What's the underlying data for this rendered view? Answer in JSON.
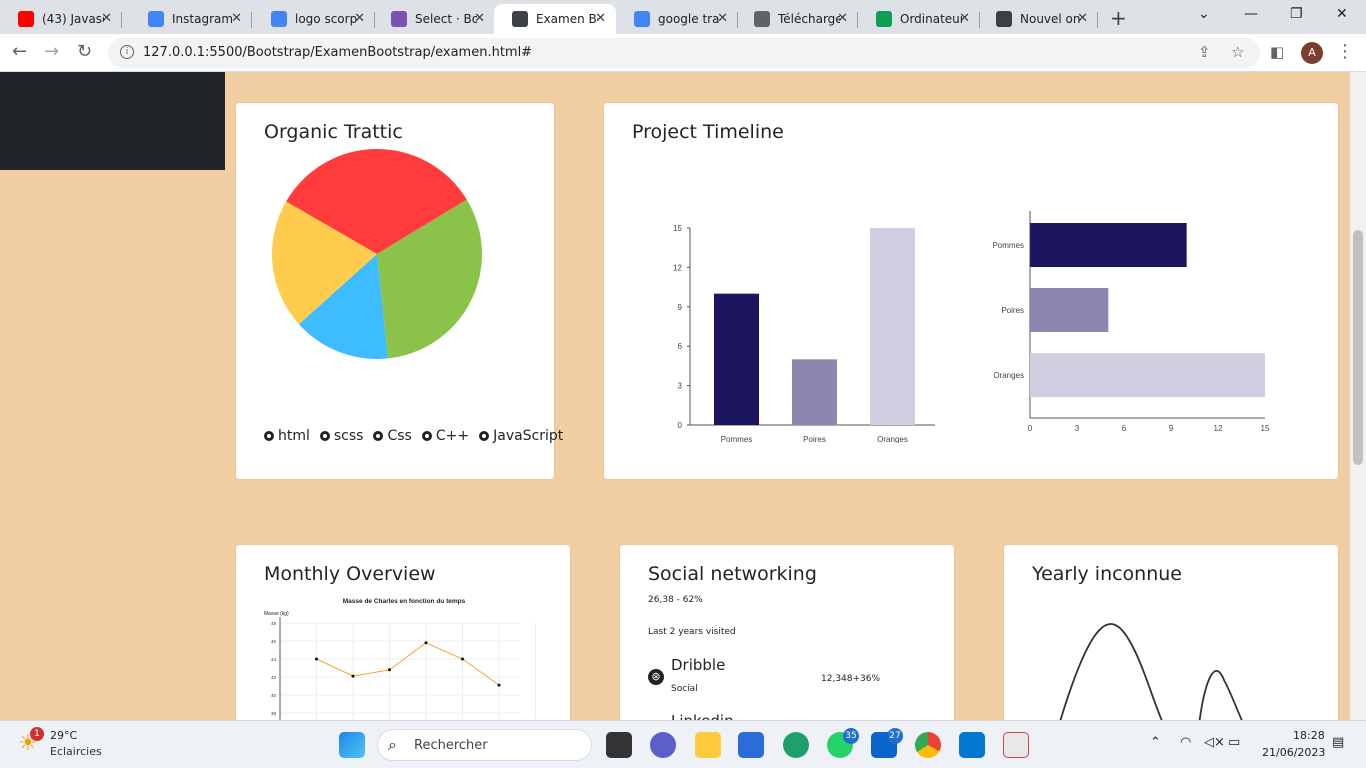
{
  "tabs": [
    {
      "label": "(43) Javasc",
      "icon": "youtube-icon",
      "color": "#ff0000"
    },
    {
      "label": "Instagram",
      "icon": "flag-icon",
      "color": "#4285f4"
    },
    {
      "label": "logo scorp",
      "icon": "google-icon",
      "color": "#4285f4"
    },
    {
      "label": "Select · Bo",
      "icon": "bootstrap-icon",
      "color": "#7952b3"
    },
    {
      "label": "Examen Bo",
      "icon": "globe-icon",
      "color": "#3c4043"
    },
    {
      "label": "google tra",
      "icon": "google-icon",
      "color": "#4285f4"
    },
    {
      "label": "Télécharge",
      "icon": "diamond-icon",
      "color": "#5f6368"
    },
    {
      "label": "Ordinateur",
      "icon": "drive-icon",
      "color": "#0f9d58"
    },
    {
      "label": "Nouvel on",
      "icon": "globe-icon",
      "color": "#3c4043"
    }
  ],
  "url": "127.0.0.1:5500/Bootstrap/ExamenBootstrap/examen.html#",
  "profile_initial": "A",
  "cards": {
    "organic": {
      "title": "Organic Trattic",
      "legend": [
        "html",
        "scss",
        "Css",
        "C++",
        "JavaScript"
      ]
    },
    "timeline": {
      "title": "Project Timeline"
    },
    "monthly": {
      "title": "Monthly Overview"
    },
    "social": {
      "title": "Social networking",
      "stat": "26,38 - 62%",
      "subtitle": "Last 2 years visited",
      "item_name": "Dribble",
      "item_sub": "Social",
      "item_value": "12,348+36%",
      "next_item": "Linkedin"
    },
    "yearly": {
      "title": "Yearly inconnue"
    }
  },
  "chart_data": [
    {
      "type": "pie",
      "categories": [
        "red",
        "green",
        "blue",
        "yellow"
      ],
      "values": [
        33,
        32,
        15,
        20
      ],
      "colors": [
        "#ff3b3b",
        "#8bc34a",
        "#3dbdff",
        "#ffcc4d"
      ],
      "legend": [
        "html",
        "scss",
        "Css",
        "C++",
        "JavaScript"
      ]
    },
    {
      "type": "bar",
      "orientation": "vertical",
      "categories": [
        "Pommes",
        "Poires",
        "Oranges"
      ],
      "values": [
        10,
        5,
        15
      ],
      "ylim": [
        0,
        15
      ],
      "yticks": [
        0,
        3,
        6,
        9,
        12,
        15
      ],
      "colors": [
        "#1c1560",
        "#8c87b1",
        "#d0cee0"
      ]
    },
    {
      "type": "bar",
      "orientation": "horizontal",
      "categories": [
        "Pommes",
        "Poires",
        "Oranges"
      ],
      "values": [
        10,
        5,
        15
      ],
      "xlim": [
        0,
        15
      ],
      "xticks": [
        0,
        3,
        6,
        9,
        12,
        15
      ],
      "colors": [
        "#1c1560",
        "#8c87b1",
        "#d0cee0"
      ]
    },
    {
      "type": "line",
      "title": "Masse de Charles en fonction du temps",
      "ylabel": "Masse (kg)",
      "yticks": [
        "36",
        "38",
        "40",
        "42",
        "44",
        "46",
        "48"
      ],
      "x": [
        1,
        2,
        3,
        4,
        5,
        6
      ],
      "values": [
        44,
        42.1,
        42.8,
        45.8,
        44,
        41.1
      ],
      "ylim": [
        36,
        48
      ],
      "color": "#f5a623"
    }
  ],
  "taskbar": {
    "weather_temp": "29°C",
    "weather_desc": "Eclaircies",
    "weather_badge": "1",
    "search_placeholder": "Rechercher",
    "whatsapp_badge": "35",
    "mail_badge": "27",
    "time": "18:28",
    "date": "21/06/2023"
  }
}
